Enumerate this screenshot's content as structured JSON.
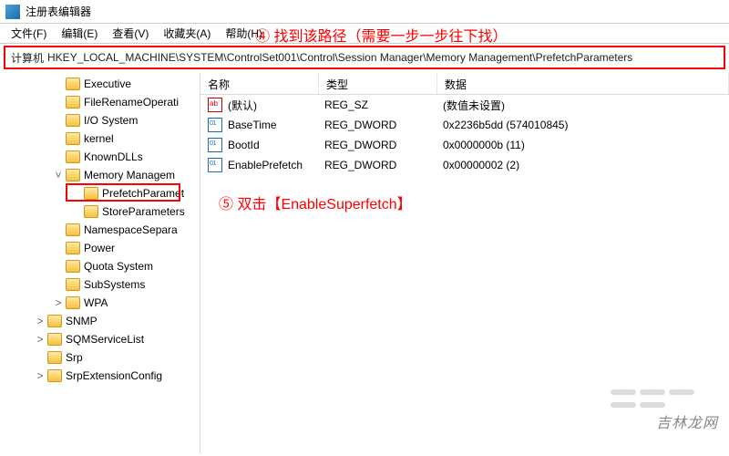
{
  "titlebar": {
    "title": "注册表编辑器"
  },
  "menubar": {
    "items": [
      "文件(F)",
      "编辑(E)",
      "查看(V)",
      "收藏夹(A)",
      "帮助(H)"
    ]
  },
  "annotations": {
    "step4": "④ 找到该路径（需要一步一步往下找）",
    "step5": "⑤ 双击【EnableSuperfetch】"
  },
  "addressbar": {
    "prefix_label": "计算机",
    "path": "HKEY_LOCAL_MACHINE\\SYSTEM\\ControlSet001\\Control\\Session Manager\\Memory Management\\PrefetchParameters"
  },
  "tree": {
    "items": [
      {
        "label": "Executive",
        "indent": 1,
        "twisty": ""
      },
      {
        "label": "FileRenameOperati",
        "indent": 1,
        "twisty": ""
      },
      {
        "label": "I/O System",
        "indent": 1,
        "twisty": ""
      },
      {
        "label": "kernel",
        "indent": 1,
        "twisty": ""
      },
      {
        "label": "KnownDLLs",
        "indent": 1,
        "twisty": ""
      },
      {
        "label": "Memory Managem",
        "indent": 1,
        "twisty": "v",
        "expanded": true
      },
      {
        "label": "PrefetchParamet",
        "indent": 2,
        "twisty": "",
        "selected": true
      },
      {
        "label": "StoreParameters",
        "indent": 2,
        "twisty": ""
      },
      {
        "label": "NamespaceSepara",
        "indent": 1,
        "twisty": ""
      },
      {
        "label": "Power",
        "indent": 1,
        "twisty": ""
      },
      {
        "label": "Quota System",
        "indent": 1,
        "twisty": ""
      },
      {
        "label": "SubSystems",
        "indent": 1,
        "twisty": ""
      },
      {
        "label": "WPA",
        "indent": 1,
        "twisty": ">"
      },
      {
        "label": "SNMP",
        "indent": 0,
        "twisty": ">"
      },
      {
        "label": "SQMServiceList",
        "indent": 0,
        "twisty": ">"
      },
      {
        "label": "Srp",
        "indent": 0,
        "twisty": ""
      },
      {
        "label": "SrpExtensionConfig",
        "indent": 0,
        "twisty": ">"
      }
    ]
  },
  "list": {
    "columns": {
      "name": "名称",
      "type": "类型",
      "data": "数据"
    },
    "rows": [
      {
        "icon": "sz",
        "name": "(默认)",
        "type": "REG_SZ",
        "data": "(数值未设置)"
      },
      {
        "icon": "dw",
        "name": "BaseTime",
        "type": "REG_DWORD",
        "data": "0x2236b5dd (574010845)"
      },
      {
        "icon": "dw",
        "name": "BootId",
        "type": "REG_DWORD",
        "data": "0x0000000b (11)"
      },
      {
        "icon": "dw",
        "name": "EnablePrefetch",
        "type": "REG_DWORD",
        "data": "0x00000002 (2)"
      }
    ]
  },
  "watermark": "吉林龙网"
}
